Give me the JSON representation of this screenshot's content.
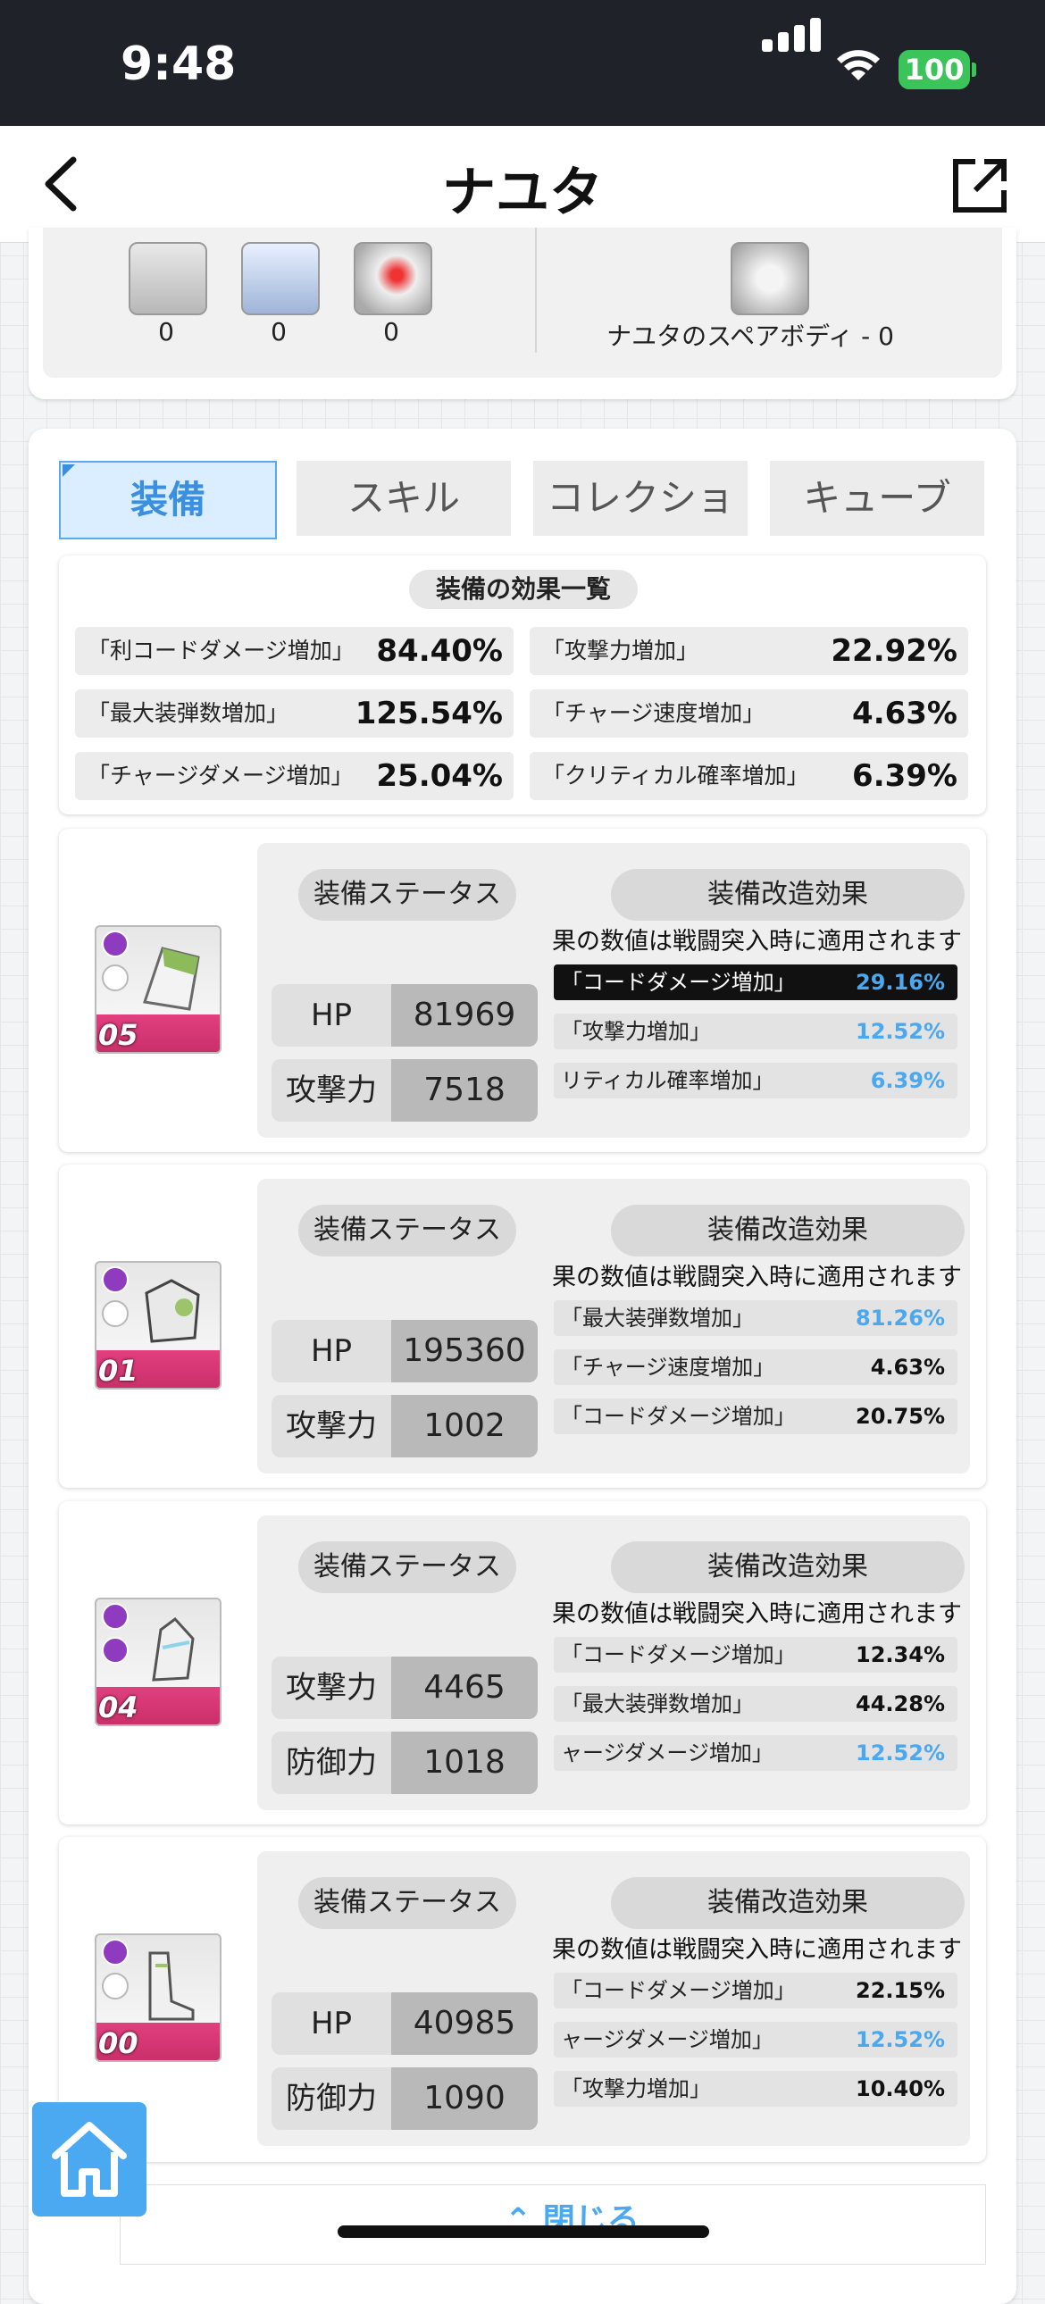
{
  "status_bar": {
    "time": "9:48",
    "battery": "100"
  },
  "nav": {
    "title": "ナユタ"
  },
  "top_card": {
    "gear_counts": [
      "0",
      "0",
      "0"
    ],
    "spare_body": "ナユタのスペアボディ - 0"
  },
  "tabs": [
    "装備",
    "スキル",
    "コレクション",
    "キューブ"
  ],
  "effects": {
    "header": "装備の効果一覧",
    "rows": [
      {
        "label": "「利コードダメージ増加」",
        "value": "84.40%"
      },
      {
        "label": "「攻撃力増加」",
        "value": "22.92%"
      },
      {
        "label": "「最大装弾数増加」",
        "value": "125.54%"
      },
      {
        "label": "「チャージ速度増加」",
        "value": "4.63%"
      },
      {
        "label": "「チャージダメージ増加」",
        "value": "25.04%"
      },
      {
        "label": "「クリティカル確率増加」",
        "value": "6.39%"
      }
    ]
  },
  "equipment": [
    {
      "level": "05",
      "status_header": "装備ステータス",
      "mod_header": "装備改造効果",
      "note": "果の数値は戦闘突入時に適用されます",
      "stats": [
        {
          "name": "HP",
          "value": "81969"
        },
        {
          "name": "攻撃力",
          "value": "7518"
        }
      ],
      "mods": [
        {
          "label": "「コードダメージ増加」",
          "value": "29.16%"
        },
        {
          "label": "「攻撃力増加」",
          "value": "12.52%"
        },
        {
          "label": "リティカル確率増加」",
          "value": "6.39%"
        }
      ]
    },
    {
      "level": "01",
      "status_header": "装備ステータス",
      "mod_header": "装備改造効果",
      "note": "果の数値は戦闘突入時に適用されます",
      "stats": [
        {
          "name": "HP",
          "value": "195360"
        },
        {
          "name": "攻撃力",
          "value": "1002"
        }
      ],
      "mods": [
        {
          "label": "「最大装弾数増加」",
          "value": "81.26%"
        },
        {
          "label": "「チャージ速度増加」",
          "value": "4.63%"
        },
        {
          "label": "「コードダメージ増加」",
          "value": "20.75%"
        }
      ]
    },
    {
      "level": "04",
      "status_header": "装備ステータス",
      "mod_header": "装備改造効果",
      "note": "果の数値は戦闘突入時に適用されます",
      "stats": [
        {
          "name": "攻撃力",
          "value": "4465"
        },
        {
          "name": "防御力",
          "value": "1018"
        }
      ],
      "mods": [
        {
          "label": "「コードダメージ増加」",
          "value": "12.34%"
        },
        {
          "label": "「最大装弾数増加」",
          "value": "44.28%"
        },
        {
          "label": "ャージダメージ増加」",
          "value": "12.52%"
        }
      ]
    },
    {
      "level": "00",
      "status_header": "装備ステータス",
      "mod_header": "装備改造効果",
      "note": "果の数値は戦闘突入時に適用されます",
      "stats": [
        {
          "name": "HP",
          "value": "40985"
        },
        {
          "name": "防御力",
          "value": "1090"
        }
      ],
      "mods": [
        {
          "label": "「コードダメージ増加」",
          "value": "22.15%"
        },
        {
          "label": "ャージダメージ増加」",
          "value": "12.52%"
        },
        {
          "label": "「攻撃力増加」",
          "value": "10.40%"
        }
      ]
    }
  ],
  "close_label": "閉じる",
  "colors": {
    "accent": "#4aa9f0",
    "highlight_row": "#111111",
    "pink": "#e23f7e"
  }
}
